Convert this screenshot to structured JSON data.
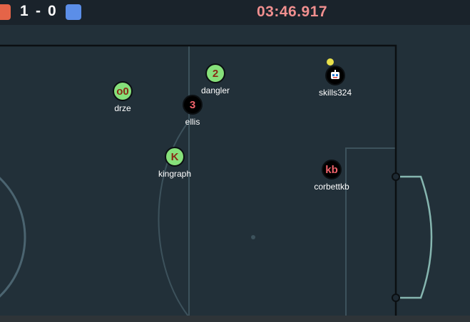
{
  "scoreboard": {
    "red_score": "1",
    "separator": "-",
    "blue_score": "0",
    "red_color": "#e56448",
    "blue_color": "#5b8ee8"
  },
  "timer": {
    "text": "03:46.917",
    "color": "#f08f8f"
  },
  "players": [
    {
      "name": "drze",
      "avatar": "o0",
      "team": "green",
      "avatar_color": "#8a2a16"
    },
    {
      "name": "dangler",
      "avatar": "2",
      "team": "green",
      "avatar_color": "#8a2a16"
    },
    {
      "name": "ellis",
      "avatar": "3",
      "team": "black",
      "avatar_color": "#f0636b"
    },
    {
      "name": "skills324",
      "avatar": "robot-face-icon",
      "team": "black",
      "avatar_color": "#ffffff"
    },
    {
      "name": "kingraph",
      "avatar": "K",
      "team": "green",
      "avatar_color": "#8a2a16"
    },
    {
      "name": "corbettkb",
      "avatar": "kb",
      "team": "black",
      "avatar_color": "#f0636b"
    }
  ],
  "colors": {
    "field": "#223039",
    "line": "#4b6470",
    "boundary": "#0b0f12",
    "goal": "#86b6b0"
  }
}
